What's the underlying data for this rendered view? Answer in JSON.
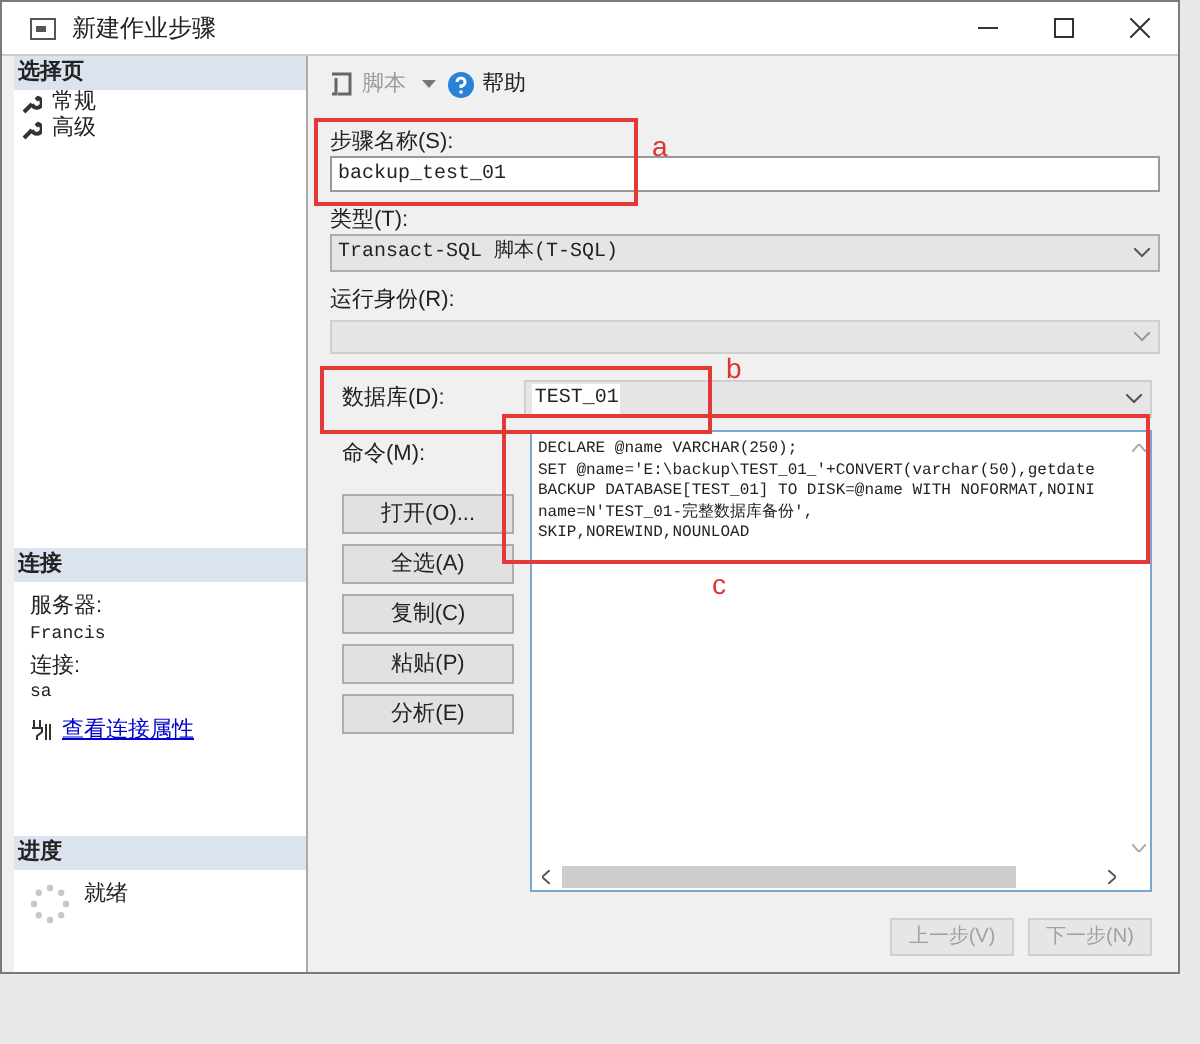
{
  "window": {
    "title": "新建作业步骤"
  },
  "sidebar": {
    "header": "选择页",
    "items": [
      {
        "label": "常规"
      },
      {
        "label": "高级"
      }
    ]
  },
  "connection": {
    "header": "连接",
    "server_label": "服务器:",
    "server": "Francis",
    "login_label": "连接:",
    "login": "sa",
    "link": "查看连接属性"
  },
  "progress": {
    "header": "进度",
    "status": "就绪"
  },
  "toolbar": {
    "script": "脚本",
    "help": "帮助"
  },
  "form": {
    "step_name_label": "步骤名称(S):",
    "step_name": "backup_test_01",
    "type_label": "类型(T):",
    "type": "Transact-SQL 脚本(T-SQL)",
    "run_as_label": "运行身份(R):",
    "database_label": "数据库(D):",
    "database": "TEST_01",
    "command_label": "命令(M):",
    "command_lines": [
      "DECLARE @name VARCHAR(250);",
      "SET @name='E:\\backup\\TEST_01_'+CONVERT(varchar(50),getdate",
      "BACKUP DATABASE[TEST_01] TO DISK=@name WITH NOFORMAT,NOINI",
      "name=N'TEST_01-完整数据库备份',",
      "SKIP,NOREWIND,NOUNLOAD"
    ],
    "command_buttons": [
      "打开(O)...",
      "全选(A)",
      "复制(C)",
      "粘贴(P)",
      "分析(E)"
    ]
  },
  "nav_buttons": [
    {
      "label": "上一步(V)",
      "disabled": true
    },
    {
      "label": "下一步(N)",
      "disabled": true
    }
  ],
  "annotations": [
    {
      "label": "a"
    },
    {
      "label": "b"
    },
    {
      "label": "c"
    }
  ]
}
